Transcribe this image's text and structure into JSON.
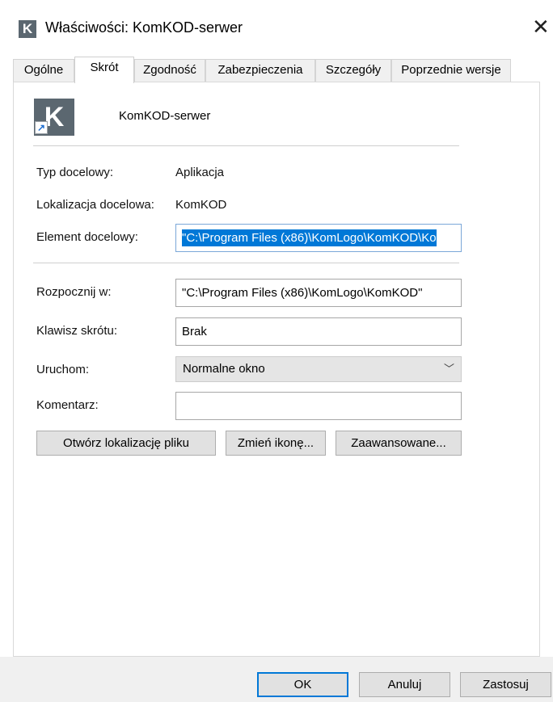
{
  "window": {
    "title": "Właściwości: KomKOD-serwer",
    "app_icon_letter": "K",
    "close_glyph": "✕"
  },
  "tabs": [
    {
      "label": "Ogólne"
    },
    {
      "label": "Skrót"
    },
    {
      "label": "Zgodność"
    },
    {
      "label": "Zabezpieczenia"
    },
    {
      "label": "Szczegóły"
    },
    {
      "label": "Poprzednie wersje"
    }
  ],
  "active_tab": "Skrót",
  "shortcut": {
    "icon": "komkod-app-icon",
    "icon_letter": "K",
    "name": "KomKOD-serwer",
    "target_type_label": "Typ docelowy:",
    "target_type_value": "Aplikacja",
    "target_location_label": "Lokalizacja docelowa:",
    "target_location_value": "KomKOD",
    "target_label": "Element docelowy:",
    "target_value": "\"C:\\Program Files (x86)\\KomLogo\\KomKOD\\Ko",
    "start_in_label": "Rozpocznij w:",
    "start_in_value": "\"C:\\Program Files (x86)\\KomLogo\\KomKOD\"",
    "hotkey_label": "Klawisz skrótu:",
    "hotkey_value": "Brak",
    "run_label": "Uruchom:",
    "run_value": "Normalne okno",
    "comment_label": "Komentarz:",
    "comment_value": ""
  },
  "actions": {
    "open_location": "Otwórz lokalizację pliku",
    "change_icon": "Zmień ikonę...",
    "advanced": "Zaawansowane..."
  },
  "footer": {
    "ok": "OK",
    "cancel": "Anuluj",
    "apply": "Zastosuj"
  },
  "colors": {
    "selection": "#0078d7",
    "icon_bg": "#5b6770"
  }
}
